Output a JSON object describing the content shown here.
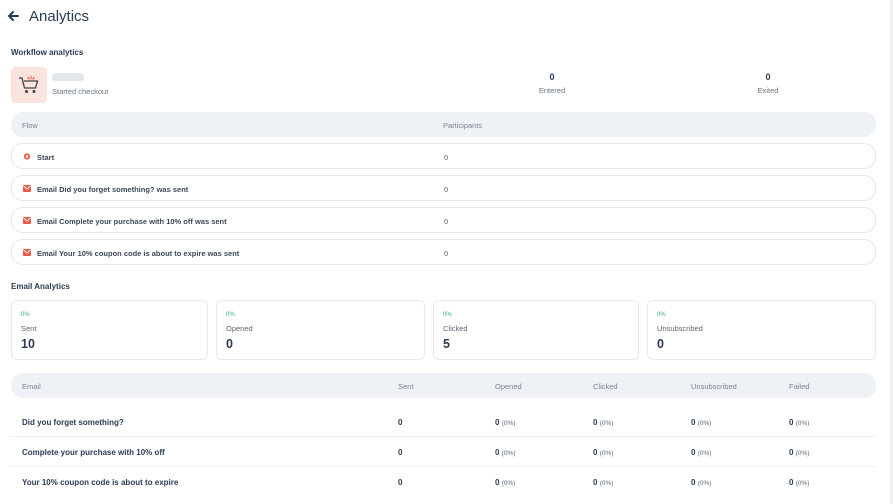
{
  "page": {
    "title": "Analytics",
    "back_icon": "arrow-left-icon"
  },
  "workflow": {
    "section_title": "Workflow analytics",
    "trigger": "Started checkout",
    "entered": {
      "value": "0",
      "label": "Entered"
    },
    "exited": {
      "value": "0",
      "label": "Exited"
    },
    "icon": "shopping-cart-icon"
  },
  "flow_table": {
    "headers": {
      "flow": "Flow",
      "participants": "Participants"
    },
    "rows": [
      {
        "name": "Start",
        "value": "0",
        "icon": "start-icon"
      },
      {
        "name": "Email Did you forget something? was sent",
        "value": "0",
        "icon": "envelope-icon"
      },
      {
        "name": "Email Complete your purchase with 10% off was sent",
        "value": "0",
        "icon": "envelope-icon"
      },
      {
        "name": "Email Your 10% coupon code is about to expire was sent",
        "value": "0",
        "icon": "envelope-icon"
      }
    ]
  },
  "email_analytics": {
    "section_title": "Email Analytics",
    "cards": [
      {
        "pct": "0%",
        "label": "Sent",
        "value": "10"
      },
      {
        "pct": "0%",
        "label": "Opened",
        "value": "0"
      },
      {
        "pct": "0%",
        "label": "Clicked",
        "value": "5"
      },
      {
        "pct": "0%",
        "label": "Unsubscribed",
        "value": "0"
      }
    ]
  },
  "email_table": {
    "headers": {
      "email": "Email",
      "sent": "Sent",
      "opened": "Opened",
      "clicked": "Clicked",
      "unsubscribed": "Unsubscribed",
      "failed": "Failed"
    },
    "rows": [
      {
        "name": "Did you forget something?",
        "sent": "0",
        "opened": "0",
        "opened_pct": "(0%)",
        "clicked": "0",
        "clicked_pct": "(0%)",
        "unsubscribed": "0",
        "unsubscribed_pct": "(0%)",
        "failed": "0",
        "failed_pct": "(0%)"
      },
      {
        "name": "Complete your purchase with 10% off",
        "sent": "0",
        "opened": "0",
        "opened_pct": "(0%)",
        "clicked": "0",
        "clicked_pct": "(0%)",
        "unsubscribed": "0",
        "unsubscribed_pct": "(0%)",
        "failed": "0",
        "failed_pct": "(0%)"
      },
      {
        "name": "Your 10% coupon code is about to expire",
        "sent": "0",
        "opened": "0",
        "opened_pct": "(0%)",
        "clicked": "0",
        "clicked_pct": "(0%)",
        "unsubscribed": "0",
        "unsubscribed_pct": "(0%)",
        "failed": "0",
        "failed_pct": "(0%)"
      }
    ]
  },
  "colors": {
    "accent": "#e8594a",
    "success": "#2eb36b",
    "header_bg": "#eef1f5",
    "text": "#2b3b55"
  }
}
